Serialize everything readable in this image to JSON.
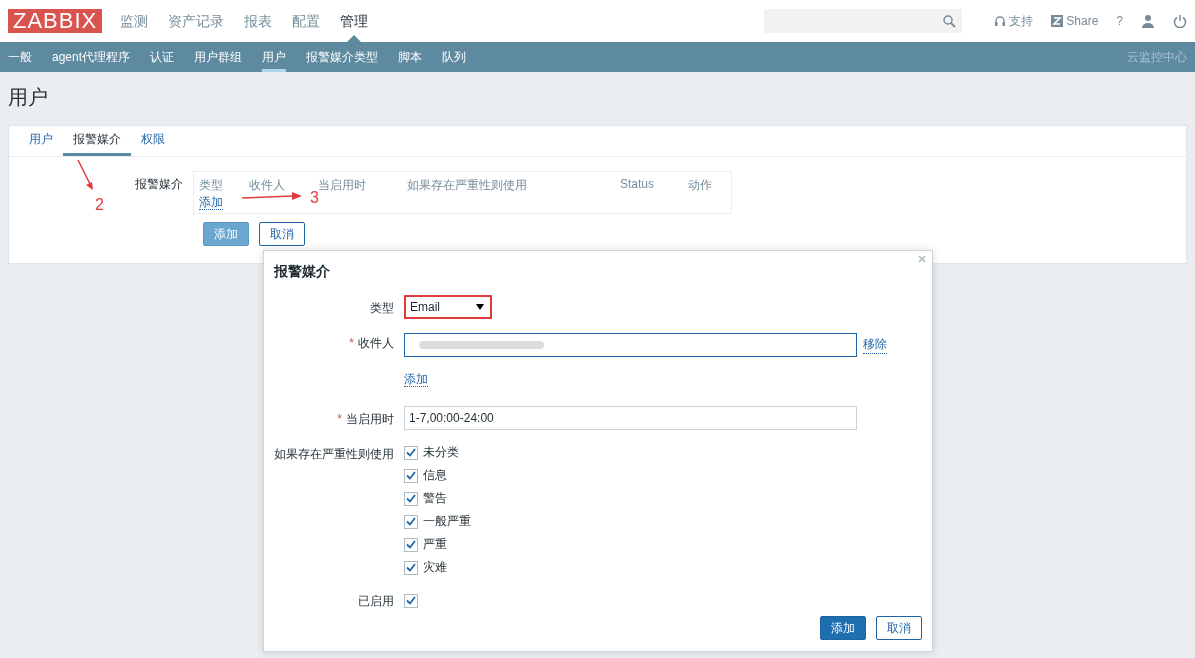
{
  "header": {
    "logo": "ZABBIX",
    "menu": [
      {
        "label": "监测",
        "selected": false
      },
      {
        "label": "资产记录",
        "selected": false
      },
      {
        "label": "报表",
        "selected": false
      },
      {
        "label": "配置",
        "selected": false
      },
      {
        "label": "管理",
        "selected": true
      }
    ],
    "tools": [
      {
        "kind": "support",
        "label": "支持"
      },
      {
        "kind": "share",
        "label": "Share"
      },
      {
        "kind": "help",
        "label": "?"
      },
      {
        "kind": "user"
      },
      {
        "kind": "logout"
      }
    ]
  },
  "subnav": {
    "items": [
      {
        "label": "一般",
        "selected": false
      },
      {
        "label": "agent代理程序",
        "selected": false
      },
      {
        "label": "认证",
        "selected": false
      },
      {
        "label": "用户群组",
        "selected": false
      },
      {
        "label": "用户",
        "selected": true
      },
      {
        "label": "报警媒介类型",
        "selected": false
      },
      {
        "label": "脚本",
        "selected": false
      },
      {
        "label": "队列",
        "selected": false
      }
    ],
    "right_link": "云监控中心"
  },
  "page_title": "用户",
  "card": {
    "tabs": [
      {
        "label": "用户",
        "selected": false
      },
      {
        "label": "报警媒介",
        "selected": true
      },
      {
        "label": "权限",
        "selected": false
      }
    ],
    "media_label": "报警媒介",
    "media_table": {
      "columns": [
        "类型",
        "收件人",
        "当启用时",
        "如果存在严重性则使用",
        "Status",
        "动作"
      ],
      "add_link": "添加"
    },
    "buttons": [
      {
        "label": "添加",
        "kind": "primary"
      },
      {
        "label": "取消",
        "kind": "secondary"
      }
    ]
  },
  "dialog": {
    "title": "报警媒介",
    "fields": [
      {
        "kind": "select",
        "label": "类型",
        "value": "Email",
        "highlighted": true
      },
      {
        "kind": "recipients",
        "label": "收件人",
        "required_mark": "*",
        "remove_link": "移除",
        "add_link": "添加"
      },
      {
        "kind": "text",
        "label": "当启用时",
        "required_mark": "*",
        "value": "1-7,00:00-24:00"
      },
      {
        "kind": "checklist",
        "label": "如果存在严重性则使用",
        "options": [
          {
            "label": "未分类",
            "checked": true
          },
          {
            "label": "信息",
            "checked": true
          },
          {
            "label": "警告",
            "checked": true
          },
          {
            "label": "一般严重",
            "checked": true
          },
          {
            "label": "严重",
            "checked": true
          },
          {
            "label": "灾难",
            "checked": true
          }
        ]
      },
      {
        "kind": "checkbox",
        "label": "已启用",
        "checked": true
      }
    ],
    "buttons": [
      {
        "label": "添加",
        "kind": "primary"
      },
      {
        "label": "取消",
        "kind": "secondary"
      }
    ]
  },
  "annotations": [
    {
      "label": "2"
    },
    {
      "label": "3"
    }
  ]
}
